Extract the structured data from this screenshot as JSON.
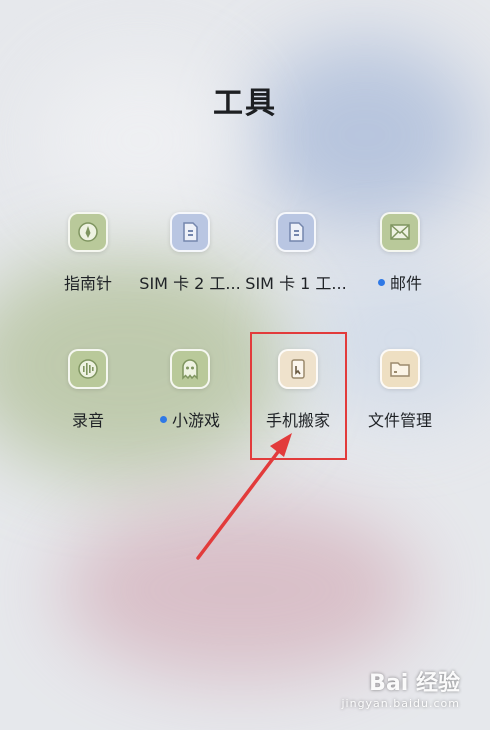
{
  "folder": {
    "title": "工具"
  },
  "apps": [
    {
      "label": "指南针",
      "icon": "compass-icon",
      "color": "#b9c99a",
      "new": false
    },
    {
      "label": "SIM 卡 2 工...",
      "icon": "sim-card-icon",
      "color": "#b9c6e2",
      "new": false
    },
    {
      "label": "SIM 卡 1 工...",
      "icon": "sim-card-icon",
      "color": "#b9c6e2",
      "new": false
    },
    {
      "label": "邮件",
      "icon": "mail-icon",
      "color": "#b9c99a",
      "new": true
    },
    {
      "label": "录音",
      "icon": "voice-recorder-icon",
      "color": "#b9c99a",
      "new": false
    },
    {
      "label": "小游戏",
      "icon": "ghost-game-icon",
      "color": "#b9c99a",
      "new": true
    },
    {
      "label": "手机搬家",
      "icon": "phone-clone-icon",
      "color": "#efe2cc",
      "new": false
    },
    {
      "label": "文件管理",
      "icon": "folder-icon",
      "color": "#eedfc2",
      "new": false
    }
  ],
  "accent_colors": {
    "highlight": "#e23b3b",
    "new_dot": "#2f79e6"
  },
  "watermark": {
    "main": "Bai 经验",
    "sub": "jingyan.baidu.com"
  }
}
